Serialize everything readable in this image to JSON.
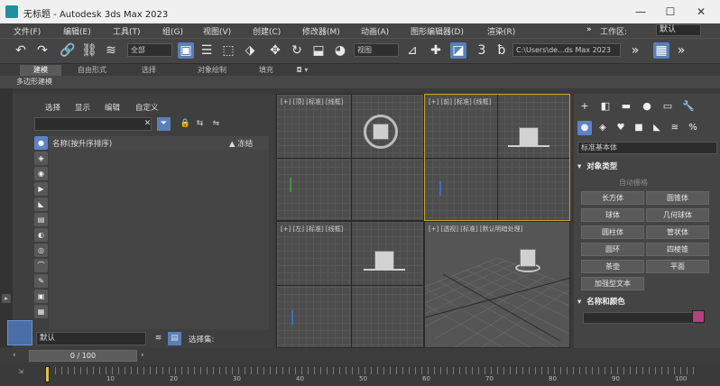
{
  "window": {
    "title": "无标题 - Autodesk 3ds Max 2023",
    "minimize": "—",
    "maximize": "☐",
    "close": "✕"
  },
  "menu": [
    {
      "label": "文件(F)"
    },
    {
      "label": "编辑(E)"
    },
    {
      "label": "工具(T)"
    },
    {
      "label": "组(G)"
    },
    {
      "label": "视图(V)"
    },
    {
      "label": "创建(C)"
    },
    {
      "label": "修改器(M)"
    },
    {
      "label": "动画(A)"
    },
    {
      "label": "图形编辑器(D)"
    },
    {
      "label": "渲染(R)"
    }
  ],
  "workspace": {
    "label": "工作区:",
    "value": "默认"
  },
  "toolbar": {
    "selection_filter": "全部",
    "ref_coord": "视图",
    "path": "C:\\Users\\de...ds Max 2023"
  },
  "ribbon_tabs": [
    "建模",
    "自由形式",
    "选择",
    "对象绘制",
    "填充"
  ],
  "ribbon_sub": "多边形建模",
  "explorer": {
    "menu": [
      "选择",
      "显示",
      "编辑",
      "自定义"
    ],
    "col_name": "名称(按升序排序)",
    "col_frozen": "▲ 冻结"
  },
  "layer": {
    "value": "默认",
    "selection_set": "选择集:"
  },
  "viewports": {
    "top": "[+] [顶] [标准] [线框]",
    "front": "[+] [前] [标准] [线框]",
    "left": "[+] [左] [标准] [线框]",
    "perspective": "[+] [透视] [标准] [默认明暗处理]"
  },
  "command_panel": {
    "category": "标准基本体",
    "rollout_object_type": "对象类型",
    "auto_grid": "自动栅格",
    "buttons": [
      "长方体",
      "圆锥体",
      "球体",
      "几何球体",
      "圆柱体",
      "管状体",
      "圆环",
      "四棱锥",
      "茶壶",
      "平面",
      "加强型文本"
    ],
    "rollout_name_color": "名称和颜色",
    "object_color": "#b3407f"
  },
  "timeline": {
    "slider": "0 / 100",
    "ticks": [
      "10",
      "20",
      "30",
      "40",
      "50",
      "60",
      "70",
      "80",
      "90",
      "100"
    ]
  }
}
